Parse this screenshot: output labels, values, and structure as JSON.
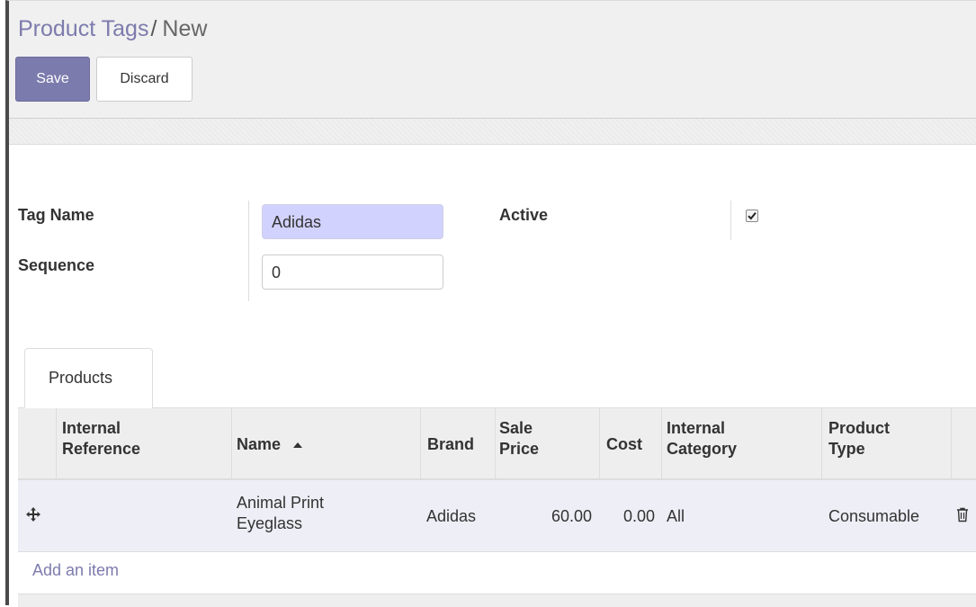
{
  "breadcrumb": {
    "parent": "Product Tags",
    "separator": "/",
    "current": "New"
  },
  "buttons": {
    "save": "Save",
    "discard": "Discard"
  },
  "form": {
    "tag_name_label": "Tag Name",
    "tag_name_value": "Adidas",
    "sequence_label": "Sequence",
    "sequence_value": "0",
    "active_label": "Active",
    "active_checked": true
  },
  "tabs": [
    {
      "label": "Products",
      "active": true
    }
  ],
  "table": {
    "columns": [
      {
        "line1": "Internal",
        "line2": "Reference"
      },
      {
        "line1": "Name",
        "line2": ""
      },
      {
        "line1": "Brand",
        "line2": ""
      },
      {
        "line1": "Sale",
        "line2": "Price"
      },
      {
        "line1": "Cost",
        "line2": ""
      },
      {
        "line1": "Internal",
        "line2": "Category"
      },
      {
        "line1": "Product",
        "line2": "Type"
      }
    ],
    "rows": [
      {
        "internal_reference": "",
        "name_line1": "Animal Print",
        "name_line2": "Eyeglass",
        "brand": "Adidas",
        "sale_price": "60.00",
        "cost": "0.00",
        "internal_category": "All",
        "product_type": "Consumable"
      }
    ],
    "add_item": "Add an item",
    "sort": {
      "column": "Name",
      "direction": "ascending"
    }
  },
  "colors": {
    "brand": "#7c7bad",
    "required_field": "#d2d2ff",
    "row_background": "#eeeef6"
  }
}
